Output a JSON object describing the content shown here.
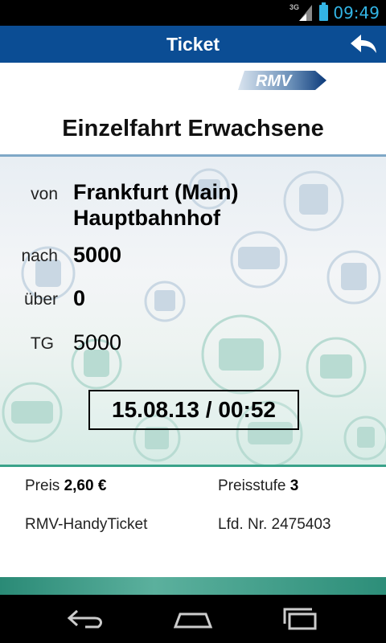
{
  "status_bar": {
    "network": "3G",
    "time": "09:49",
    "accent_color": "#33b5e5"
  },
  "title_bar": {
    "title": "Ticket",
    "back_icon": "back-arrow-icon",
    "color": "#0b4d94"
  },
  "logo": {
    "text": "RMV"
  },
  "ticket": {
    "name": "Einzelfahrt Erwachsene",
    "rows": {
      "von_label": "von",
      "von_line1": "Frankfurt (Main)",
      "von_line2": "Hauptbahnhof",
      "nach_label": "nach",
      "nach_value": "5000",
      "ueber_label": "über",
      "ueber_value": "0",
      "tg_label": "TG",
      "tg_value": "5000"
    },
    "datetime": "15.08.13 / 00:52"
  },
  "info": {
    "price_label": "Preis",
    "price_value": "2,60 €",
    "zone_label": "Preisstufe",
    "zone_value": "3",
    "product": "RMV-HandyTicket",
    "serial_label": "Lfd. Nr.",
    "serial_value": "2475403"
  },
  "nav_bar": {
    "buttons": [
      "back-icon",
      "home-icon",
      "recent-apps-icon"
    ]
  }
}
